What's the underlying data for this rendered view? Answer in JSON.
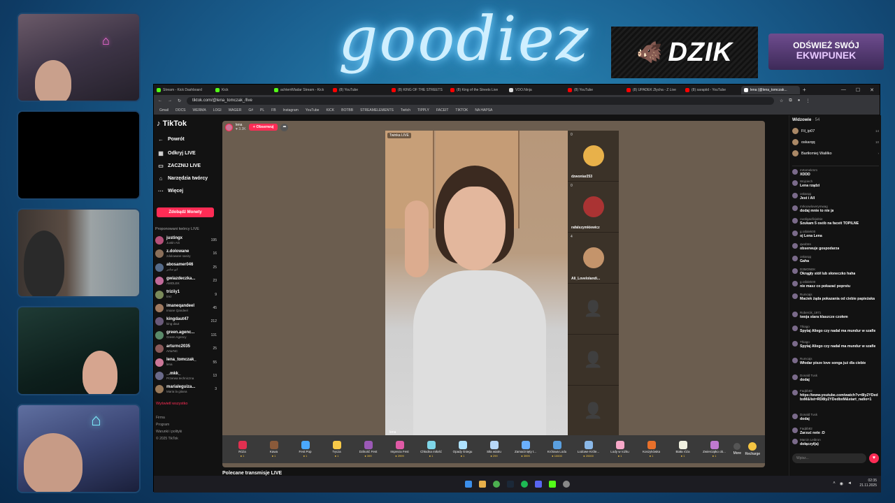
{
  "overlay": {
    "logo": "goodiez",
    "sponsor": "DZIK",
    "promo_line1": "ODŚWIEŻ SWÓJ",
    "promo_line2": "EKWIPUNEK"
  },
  "browser": {
    "tabs": [
      {
        "label": "Stream - Kick Dashboard",
        "color": "#53fc18"
      },
      {
        "label": "Kick",
        "color": "#53fc18"
      },
      {
        "label": "achtenWladar Stream - Kick",
        "color": "#53fc18"
      },
      {
        "label": "(8) YouTube",
        "color": "#ff0000"
      },
      {
        "label": "(8) KING OF THE STREETS",
        "color": "#ff0000"
      },
      {
        "label": "(8) King of the Streets Live",
        "color": "#ff0000"
      },
      {
        "label": "VDO.Ninja",
        "color": "#dddddd"
      },
      {
        "label": "(8) YouTube",
        "color": "#ff0000"
      },
      {
        "label": "(8) UPADEK Złycha - Z Live",
        "color": "#ff0000"
      },
      {
        "label": "(8) sarapiid - YouTube",
        "color": "#ff0000"
      },
      {
        "label": "lena (@lena_tomczak...",
        "color": "#ffffff"
      }
    ],
    "url": "tiktok.com/@lena_tomczak_/live",
    "bookmarks": [
      "Gmail",
      "DOCS",
      "WERMA",
      "LOGI",
      "WAGER",
      "G#",
      "PL",
      "FB",
      "Instagram",
      "YouTube",
      "KICK",
      "BOTBB",
      "STREAMELEMENTS",
      "Twitch",
      "TIPPLY",
      "FACEIT",
      "TIKTOK",
      "NA HAPSA"
    ]
  },
  "tiktok": {
    "brand": "TikTok",
    "nav": [
      {
        "icon": "←",
        "label": "Powrót"
      },
      {
        "icon": "▦",
        "label": "Odkryj LIVE"
      },
      {
        "icon": "▭",
        "label": "ZACZNIJ LIVE"
      },
      {
        "icon": "⌂",
        "label": "Narzędzia twórcy"
      },
      {
        "icon": "···",
        "label": "Więcej"
      }
    ],
    "coins_button": "Zdobądź Monety",
    "suggested_header": "Proponowani twórcy LIVE",
    "suggested": [
      {
        "name": "justingx",
        "sub": "Justin AG",
        "count": "195"
      },
      {
        "name": "z.dolowane",
        "sub": "zdolowane sasiry",
        "count": "16"
      },
      {
        "name": "abosamer046",
        "sub": "ابو سامر",
        "count": "25"
      },
      {
        "name": "gwiazdeczka...",
        "sub": "AMOLEK",
        "count": "23"
      },
      {
        "name": "triziiy1",
        "sub": "trez",
        "count": "9"
      },
      {
        "name": "imaneqandeel",
        "sub": "Imane Qandeel",
        "count": "45"
      },
      {
        "name": "kingdaut47",
        "sub": "king daut",
        "count": "212"
      },
      {
        "name": "green.agenc...",
        "sub": "Green Agency",
        "count": "131"
      },
      {
        "name": "arturnc2035",
        "sub": "ArturNC",
        "count": "25"
      },
      {
        "name": "lena_tomczak_",
        "sub": "lena",
        "count": "55"
      },
      {
        "name": "_.mkk_",
        "sub": "Przerwa techniczna",
        "count": "13"
      },
      {
        "name": "marialeguiza...",
        "sub": "Maria la gitana",
        "count": "3"
      }
    ],
    "show_all": "Wyświetl wszystko",
    "footer": [
      "Firma",
      "Program",
      "Warunki i polityki",
      "© 2025 TikTok"
    ],
    "host_name": "lena",
    "host_likes": "3.3K",
    "follow_label": "+ Obserwuj",
    "video_tag": "Twinka LIVE",
    "video_caption": "lena",
    "guests": [
      {
        "name": "dzwoniar253",
        "count": "0",
        "color": "#e8b14a"
      },
      {
        "name": "rafalszymkiewicz",
        "count": "0",
        "color": "#a33"
      },
      {
        "name": "Ali_Lovelolandi...",
        "count": "4",
        "color": "#c4946b"
      }
    ],
    "gifts": [
      {
        "name": "Róża",
        "price": "1",
        "color": "#e03050"
      },
      {
        "name": "Kawa",
        "price": "1",
        "color": "#8a5a3a"
      },
      {
        "name": "Fest Pop",
        "price": "1",
        "color": "#4aa8ff"
      },
      {
        "name": "Tęcza",
        "price": "1",
        "color": "#f7c948"
      },
      {
        "name": "Dzikość Fest",
        "price": "399",
        "color": "#9b59b6"
      },
      {
        "name": "Impreza Fest",
        "price": "2999",
        "color": "#e05aa6"
      },
      {
        "name": "Chłodna miłość",
        "price": "1",
        "color": "#7fd6e8"
      },
      {
        "name": "Opady śniegu",
        "price": "1",
        "color": "#aee2ff"
      },
      {
        "name": "Siła wiatru",
        "price": "299",
        "color": "#b7d7f7"
      },
      {
        "name": "Zamarznięty t...",
        "price": "3999",
        "color": "#6ab0ff"
      },
      {
        "name": "Królowa Lodu",
        "price": "10000",
        "color": "#5aa0e0"
      },
      {
        "name": "Lodowe Króle...",
        "price": "20000",
        "color": "#8ab8e8"
      },
      {
        "name": "Lody w rożku",
        "price": "1",
        "color": "#f7a8c8"
      },
      {
        "name": "Koszykówka",
        "price": "1",
        "color": "#e8702a"
      },
      {
        "name": "Biała róża",
        "price": "1",
        "color": "#f0f0e0"
      },
      {
        "name": "Zwierciątko ob...",
        "price": "1",
        "color": "#c07ad0"
      }
    ],
    "more_label": "More",
    "recharge_label": "Recharge",
    "recommended": "Polecane transmisje LIVE",
    "viewers_label": "Widzowie",
    "viewers_count": "· 54",
    "top_viewers": [
      {
        "name": "Fil_ip07",
        "count": "14"
      },
      {
        "name": "oskarqq",
        "count": "10"
      },
      {
        "name": "Bartłomiej Waliłko",
        "count": "›"
      }
    ],
    "messages": [
      {
        "user": "mrtomekmm",
        "text": "XDDD"
      },
      {
        "user": "Wojciech",
        "text": "Lena rządzi"
      },
      {
        "user": "oskarqq",
        "text": "Jest i All"
      },
      {
        "user": "mrkoowloverymwag",
        "text": "dodaj mnie to nie ja"
      },
      {
        "user": "cwoligaoficjalnie",
        "text": "Szukam 5 osób na faceit TOPILNE"
      },
      {
        "user": "g.rafalek00",
        "text": "oj Lena Lena"
      },
      {
        "user": "qwobtre",
        "text": "obserwuje gospodarza"
      },
      {
        "user": "oskarqq",
        "text": "Gaha"
      },
      {
        "user": "D3MONEK",
        "text": "Okrągły stół lub słoneczko haha"
      },
      {
        "user": "g.rafalek00",
        "text": "nie masz co pokazać poprstu"
      },
      {
        "user": "Rumcajs",
        "text": "Maciek żąda pokazania od ciebie papieżaka"
      },
      {
        "user": "Robercik_1971",
        "text": "twoja stara klaszcze czołem"
      },
      {
        "user": "Thiago",
        "text": "Spytaj Aliego czy nadal ma mundur w szafie"
      },
      {
        "user": "Thiago",
        "text": "Spytaj Aliego czy nadal ma mundur w szafie"
      },
      {
        "user": "Rumcajs",
        "text": "Włodar pisze love songa już dla ciebie"
      },
      {
        "user": "Donald Tusk",
        "text": "dodaj"
      },
      {
        "user": "Faqbb82",
        "text": "https://www.youtube.com/watch?v=8ly2YDedbxM&list=RD8ly2YDedbxM&start_radio=1"
      },
      {
        "user": "Donald Tusk",
        "text": "dodaj"
      },
      {
        "user": "Faqbb82",
        "text": "Zarzuć nete :D"
      },
      {
        "user": "Marcin Leibron",
        "text": "dołączył(a)"
      }
    ],
    "chat_placeholder": "Wpisz..."
  },
  "taskbar": {
    "time": "02:35",
    "date": "21.11.2025"
  }
}
